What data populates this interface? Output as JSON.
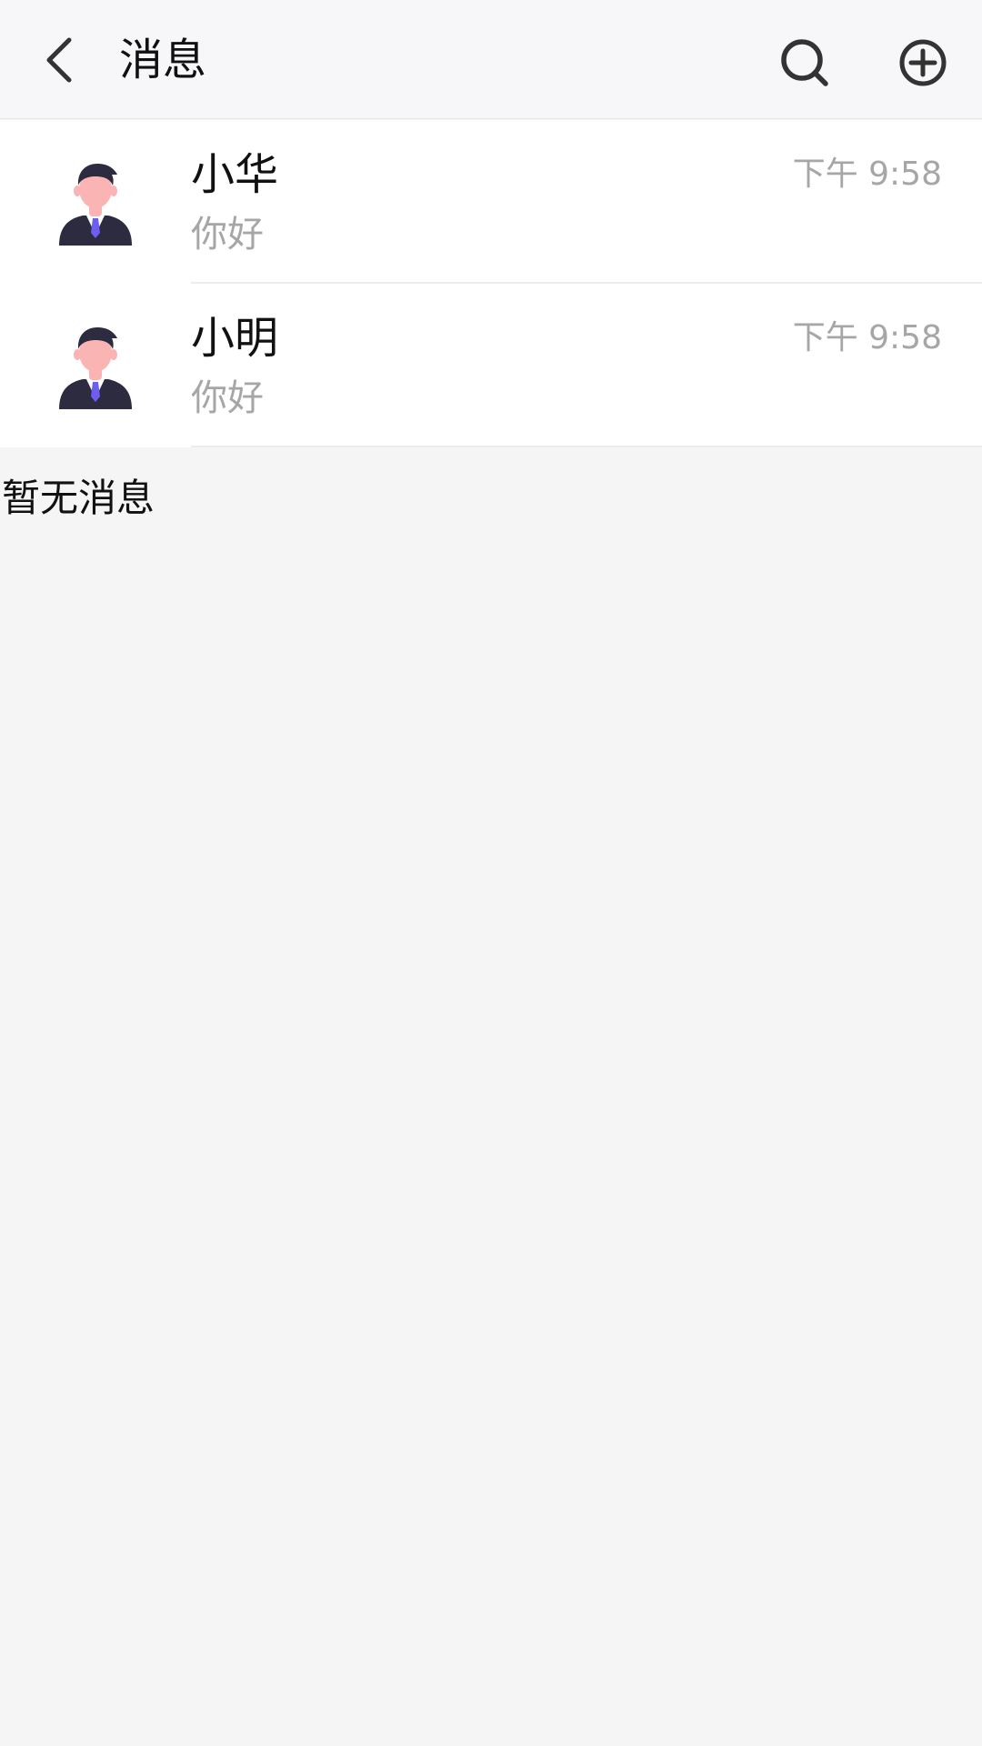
{
  "header": {
    "title": "消息",
    "back_icon": "chevron-left-icon",
    "search_icon": "search-icon",
    "add_icon": "plus-circle-icon"
  },
  "conversations": [
    {
      "name": "小华",
      "time": "下午 9:58",
      "preview": "你好",
      "avatar_icon": "user-avatar-icon"
    },
    {
      "name": "小明",
      "time": "下午 9:58",
      "preview": "你好",
      "avatar_icon": "user-avatar-icon"
    }
  ],
  "empty_text": "暂无消息",
  "colors": {
    "header_bg": "#f7f7f9",
    "page_bg": "#f5f5f6",
    "list_bg": "#ffffff",
    "text_primary": "#111111",
    "text_secondary": "#a6a6a6",
    "avatar_suit": "#2c2b40",
    "avatar_skin": "#fbb4b4",
    "avatar_tie": "#6d5ef0"
  }
}
